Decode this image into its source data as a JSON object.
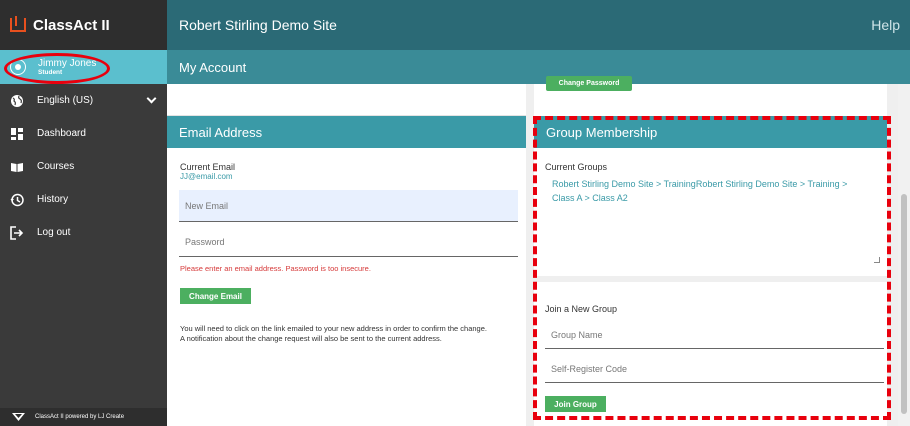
{
  "app": {
    "brand": "ClassAct II",
    "site_title": "Robert Stirling Demo Site",
    "help": "Help"
  },
  "user": {
    "name": "Jimmy Jones",
    "role": "Student"
  },
  "sidebar": {
    "items": [
      {
        "label": "English (US)",
        "icon": "globe-icon"
      },
      {
        "label": "Dashboard",
        "icon": "dashboard-icon"
      },
      {
        "label": "Courses",
        "icon": "book-icon"
      },
      {
        "label": "History",
        "icon": "history-icon"
      },
      {
        "label": "Log out",
        "icon": "logout-icon"
      }
    ],
    "footer": "ClassAct II powered by LJ Create"
  },
  "page": {
    "title": "My Account"
  },
  "email_section": {
    "header": "Email Address",
    "current_label": "Current Email",
    "current_value": "JJ@email.com",
    "new_email_placeholder": "New Email",
    "password_placeholder": "Password",
    "error": "Please enter an email address. Password is too insecure.",
    "button": "Change Email",
    "note_line1": "You will need to click on the link emailed to your new address in order to confirm the change.",
    "note_line2": "A notification about the change request will also be sent to the current address."
  },
  "password_section": {
    "button": "Change Password"
  },
  "group_section": {
    "header": "Group Membership",
    "current_label": "Current Groups",
    "groups_line1": "Robert Stirling Demo Site > TrainingRobert Stirling Demo Site > Training >",
    "groups_line2": "Class A > Class A2",
    "join_label": "Join a New Group",
    "group_name_placeholder": "Group Name",
    "code_placeholder": "Self-Register Code",
    "button": "Join Group"
  },
  "colors": {
    "sidebar_bg": "#3a3a3a",
    "active_item": "#5bbfce",
    "header_dark": "#2b6a76",
    "header_mid": "#3a8b97",
    "panel_header": "#3a9aa7",
    "button_green": "#4caf60",
    "error_red": "#d63a3a",
    "highlight_red": "#e8000d"
  }
}
